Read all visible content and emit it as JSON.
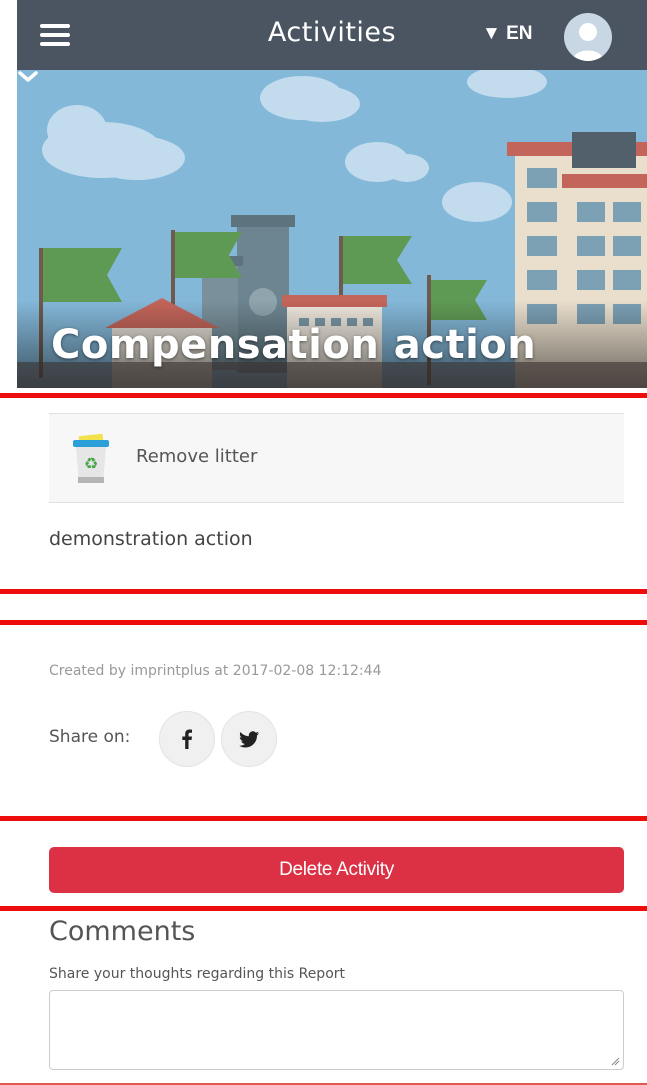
{
  "topbar": {
    "title": "Activities",
    "language": "▼ EN"
  },
  "hero": {
    "title": "Compensation action"
  },
  "activity": {
    "action_icon": "recycle-bin-icon",
    "action_label": "Remove litter",
    "description": "demonstration action"
  },
  "meta": {
    "created_text": "Created by imprintplus at 2017-02-08 12:12:44",
    "share_label": "Share on:"
  },
  "buttons": {
    "delete_label": "Delete Activity"
  },
  "comments": {
    "title": "Comments",
    "hint": "Share your thoughts regarding this Report",
    "value": ""
  },
  "colors": {
    "topbar": "#4a5561",
    "delete": "#dc3045",
    "separator": "#ee0d0d"
  }
}
